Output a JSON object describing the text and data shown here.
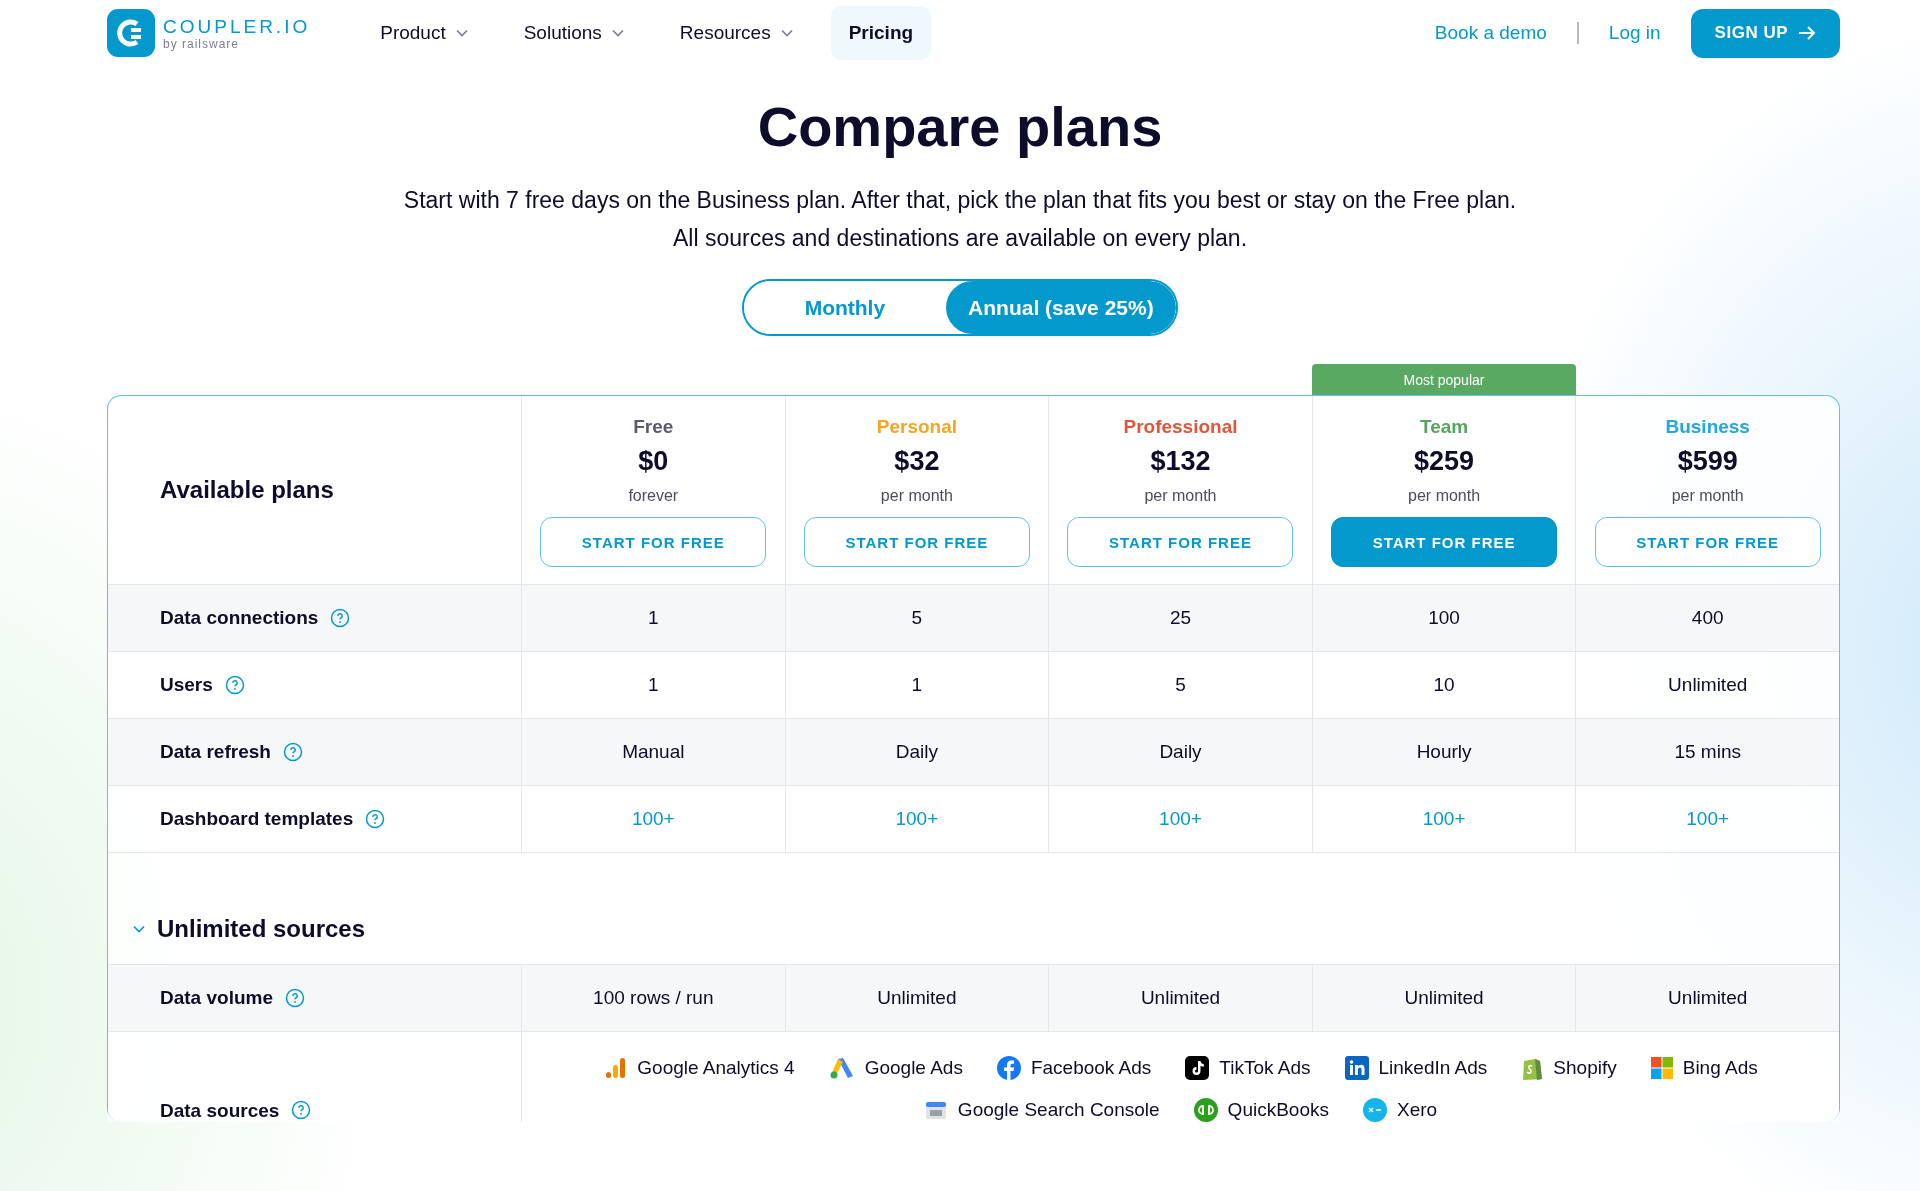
{
  "header": {
    "logo": {
      "name": "COUPLER.IO",
      "byline": "by railsware"
    },
    "nav": [
      {
        "label": "Product",
        "dropdown": true,
        "selected": false
      },
      {
        "label": "Solutions",
        "dropdown": true,
        "selected": false
      },
      {
        "label": "Resources",
        "dropdown": true,
        "selected": false
      },
      {
        "label": "Pricing",
        "dropdown": false,
        "selected": true
      }
    ],
    "links": [
      "Book a demo",
      "Log in"
    ],
    "signup": "SIGN UP"
  },
  "title": "Compare plans",
  "subtitle": [
    "Start with 7 free days on the Business plan. After that, pick the plan that fits you best or stay on the Free plan.",
    "All sources and destinations are available on every plan."
  ],
  "billing": [
    {
      "label": "Monthly",
      "selected": false
    },
    {
      "label": "Annual (save 25%)",
      "selected": true
    }
  ],
  "table": {
    "heading": "Available plans",
    "plans": [
      {
        "name": "Free",
        "color": "#5b5b70",
        "price": "$0",
        "period": "forever",
        "button": "START FOR FREE",
        "popular": false
      },
      {
        "name": "Personal",
        "color": "#f5a524",
        "price": "$32",
        "period": "per month",
        "button": "START FOR FREE",
        "popular": false
      },
      {
        "name": "Professional",
        "color": "#e2553a",
        "price": "$132",
        "period": "per month",
        "button": "START FOR FREE",
        "popular": false
      },
      {
        "name": "Team",
        "color": "#56a55e",
        "price": "$259",
        "period": "per month",
        "button": "START FOR FREE",
        "popular": true,
        "badge": "Most popular"
      },
      {
        "name": "Business",
        "color": "#21a8dc",
        "price": "$599",
        "period": "per month",
        "button": "START FOR FREE",
        "popular": false
      }
    ],
    "rows": [
      {
        "label": "Data connections",
        "kind": "text",
        "values": [
          "1",
          "5",
          "25",
          "100",
          "400"
        ]
      },
      {
        "label": "Users",
        "kind": "text",
        "values": [
          "1",
          "1",
          "5",
          "10",
          "Unlimited"
        ]
      },
      {
        "label": "Data refresh",
        "kind": "text",
        "values": [
          "Manual",
          "Daily",
          "Daily",
          "Hourly",
          "15 mins"
        ]
      },
      {
        "label": "Dashboard templates",
        "kind": "link",
        "values": [
          "100+",
          "100+",
          "100+",
          "100+",
          "100+"
        ]
      }
    ],
    "section": {
      "title": "Unlimited sources",
      "expanded": true,
      "rows": [
        {
          "label": "Data volume",
          "kind": "text",
          "values": [
            "100 rows / run",
            "Unlimited",
            "Unlimited",
            "Unlimited",
            "Unlimited"
          ]
        }
      ],
      "sources_label": "Data sources",
      "sources": [
        "Google Analytics 4",
        "Google Ads",
        "Facebook Ads",
        "TikTok Ads",
        "LinkedIn Ads",
        "Shopify",
        "Bing Ads",
        "Google Search Console",
        "QuickBooks",
        "Xero"
      ]
    }
  }
}
